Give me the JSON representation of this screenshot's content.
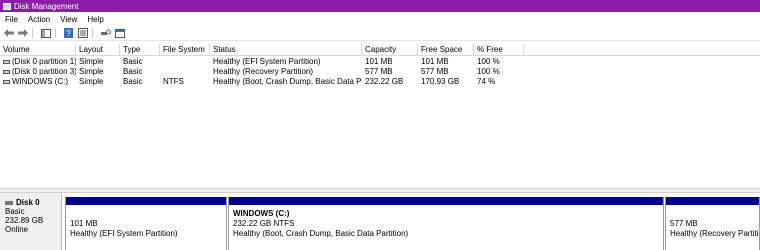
{
  "window": {
    "title": "Disk Management"
  },
  "menu": [
    "File",
    "Action",
    "View",
    "Help"
  ],
  "toolbar_icons": [
    "back-arrow-icon",
    "forward-arrow-icon",
    "console-tree-icon",
    "help-icon",
    "properties-icon",
    "rescan-icon",
    "disk-view-icon"
  ],
  "columns": [
    "Volume",
    "Layout",
    "Type",
    "File System",
    "Status",
    "Capacity",
    "Free Space",
    "% Free"
  ],
  "volumes": [
    {
      "volume": "(Disk 0 partition 1)",
      "layout": "Simple",
      "type": "Basic",
      "fs": "",
      "status": "Healthy (EFI System Partition)",
      "capacity": "101 MB",
      "free": "101 MB",
      "pct": "100 %"
    },
    {
      "volume": "(Disk 0 partition 3)",
      "layout": "Simple",
      "type": "Basic",
      "fs": "",
      "status": "Healthy (Recovery Partition)",
      "capacity": "577 MB",
      "free": "577 MB",
      "pct": "100 %"
    },
    {
      "volume": "WINDOWS (C:)",
      "layout": "Simple",
      "type": "Basic",
      "fs": "NTFS",
      "status": "Healthy (Boot, Crash Dump, Basic Data Partiti...",
      "capacity": "232.22 GB",
      "free": "170.93 GB",
      "pct": "74 %"
    }
  ],
  "disk": {
    "name": "Disk 0",
    "type": "Basic",
    "size": "232.89 GB",
    "state": "Online",
    "partitions": [
      {
        "name": "",
        "size": "101 MB",
        "status": "Healthy (EFI System Partition)"
      },
      {
        "name": "WINDOWS  (C:)",
        "size": "232.22 GB NTFS",
        "status": "Healthy (Boot, Crash Dump, Basic Data Partition)"
      },
      {
        "name": "",
        "size": "577 MB",
        "status": "Healthy (Recovery Partition)"
      }
    ]
  },
  "colors": {
    "titlebar": "#8a1ea8",
    "partition_bar": "#00008b"
  }
}
